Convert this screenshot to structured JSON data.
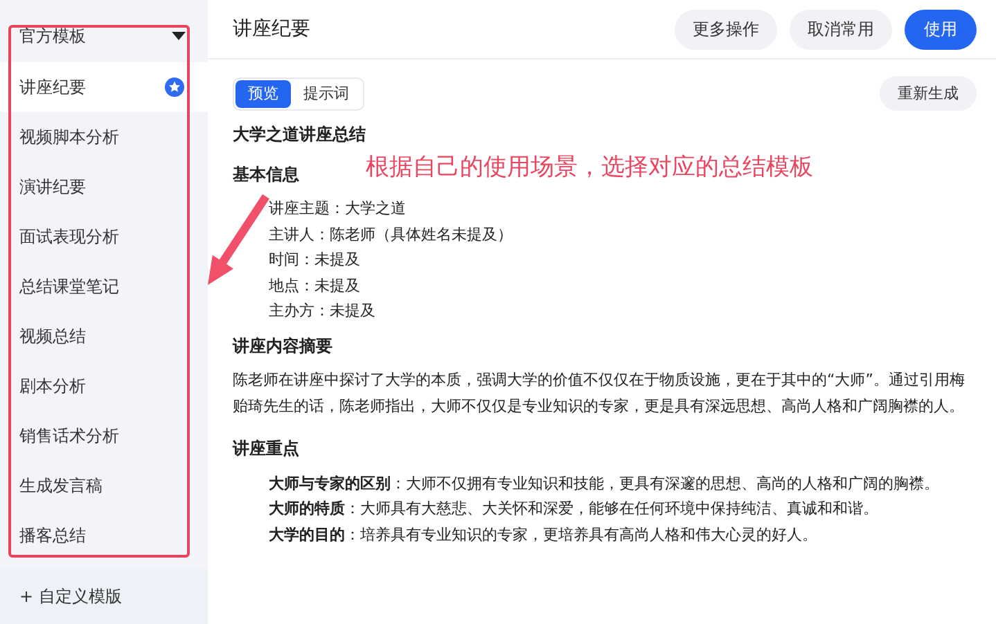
{
  "sidebar": {
    "header": {
      "label": "官方模板",
      "expanded": true
    },
    "items": [
      {
        "label": "讲座纪要",
        "selected": true,
        "starred": true
      },
      {
        "label": "视频脚本分析",
        "selected": false,
        "starred": false
      },
      {
        "label": "演讲纪要",
        "selected": false,
        "starred": false
      },
      {
        "label": "面试表现分析",
        "selected": false,
        "starred": false
      },
      {
        "label": "总结课堂笔记",
        "selected": false,
        "starred": false
      },
      {
        "label": "视频总结",
        "selected": false,
        "starred": false
      },
      {
        "label": "剧本分析",
        "selected": false,
        "starred": false
      },
      {
        "label": "销售话术分析",
        "selected": false,
        "starred": false
      },
      {
        "label": "生成发言稿",
        "selected": false,
        "starred": false
      },
      {
        "label": "播客总结",
        "selected": false,
        "starred": false
      }
    ],
    "footer": {
      "icon": "+",
      "label": "自定义模版"
    }
  },
  "header": {
    "title": "讲座纪要",
    "buttons": [
      {
        "label": "更多操作",
        "kind": "secondary"
      },
      {
        "label": "取消常用",
        "kind": "secondary"
      },
      {
        "label": "使用",
        "kind": "primary"
      }
    ]
  },
  "tabs": [
    {
      "label": "预览",
      "selected": true
    },
    {
      "label": "提示词",
      "selected": false
    }
  ],
  "regenerate": "重新生成",
  "document": [
    {
      "kind": "title",
      "text": "大学之道讲座总结"
    },
    {
      "kind": "heading",
      "text": "基本信息"
    },
    {
      "kind": "field",
      "label": "讲座主题",
      "value": "：大学之道"
    },
    {
      "kind": "field",
      "label": "主讲人",
      "value": "：陈老师（具体姓名未提及）"
    },
    {
      "kind": "field",
      "label": "时间",
      "value": "：未提及"
    },
    {
      "kind": "field",
      "label": "地点",
      "value": "：未提及"
    },
    {
      "kind": "field",
      "label": "主办方",
      "value": "：未提及"
    },
    {
      "kind": "heading",
      "text": "讲座内容摘要"
    },
    {
      "kind": "paragraph",
      "text": "陈老师在讲座中探讨了大学的本质，强调大学的价值不仅仅在于物质设施，更在于其中的“大师”。通过引用梅贻琦先生的话，陈老师指出，大师不仅仅是专业知识的专家，更是具有深远思想、高尚人格和广阔胸襟的人。"
    },
    {
      "kind": "heading",
      "text": "讲座重点"
    },
    {
      "kind": "point",
      "label": "大师与专家的区别",
      "value": "：大师不仅拥有专业知识和技能，更具有深邃的思想、高尚的人格和广阔的胸襟。"
    },
    {
      "kind": "point",
      "label": "大师的特质",
      "value": "：大师具有大慈悲、大关怀和深爱，能够在任何环境中保持纯洁、真诚和和谐。"
    },
    {
      "kind": "point",
      "label": "大学的目的",
      "value": "：培养具有专业知识的专家，更培养具有高尚人格和伟大心灵的好人。"
    }
  ],
  "annotation": {
    "text": "根据自己的使用场景，选择对应的总结模板"
  }
}
